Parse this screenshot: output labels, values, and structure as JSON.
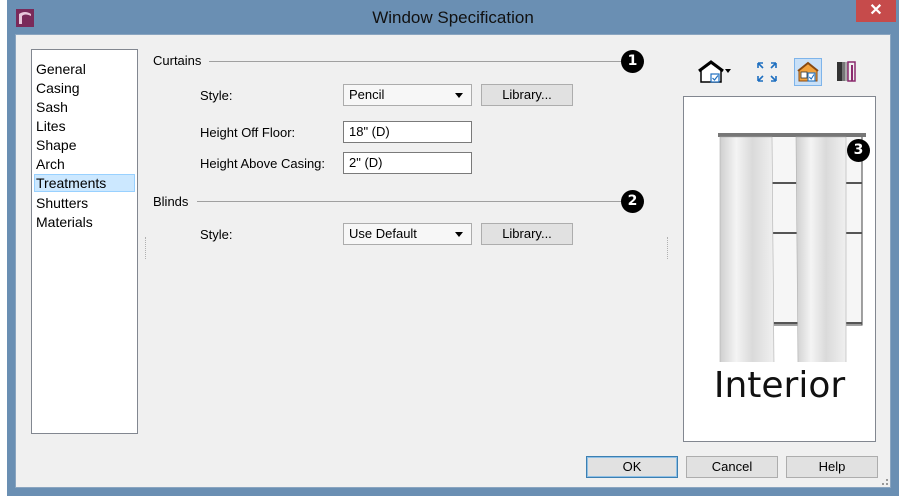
{
  "window": {
    "title": "Window Specification",
    "close_label": "✕"
  },
  "nav": {
    "items": [
      {
        "label": "General"
      },
      {
        "label": "Casing"
      },
      {
        "label": "Sash"
      },
      {
        "label": "Lites"
      },
      {
        "label": "Shape"
      },
      {
        "label": "Arch"
      },
      {
        "label": "Treatments",
        "selected": true
      },
      {
        "label": "Shutters"
      },
      {
        "label": "Materials"
      }
    ]
  },
  "curtains": {
    "group_label": "Curtains",
    "callout": "1",
    "style_label": "Style:",
    "style_value": "Pencil",
    "library_label": "Library...",
    "height_off_floor_label": "Height Off Floor:",
    "height_off_floor_value": "18\" (D)",
    "height_above_casing_label": "Height Above Casing:",
    "height_above_casing_value": "2\" (D)"
  },
  "blinds": {
    "group_label": "Blinds",
    "callout": "2",
    "style_label": "Style:",
    "style_value": "Use Default",
    "library_label": "Library..."
  },
  "preview": {
    "callout": "3",
    "caption": "Interior"
  },
  "toolbar": {
    "icons": [
      "camera-view-icon",
      "fit-to-window-icon",
      "color-preview-icon",
      "material-view-icon"
    ]
  },
  "footer": {
    "ok_label": "OK",
    "cancel_label": "Cancel",
    "help_label": "Help"
  },
  "colors": {
    "frame": "#6a8fb3",
    "close": "#c64b4b",
    "selection": "#cce8ff"
  }
}
